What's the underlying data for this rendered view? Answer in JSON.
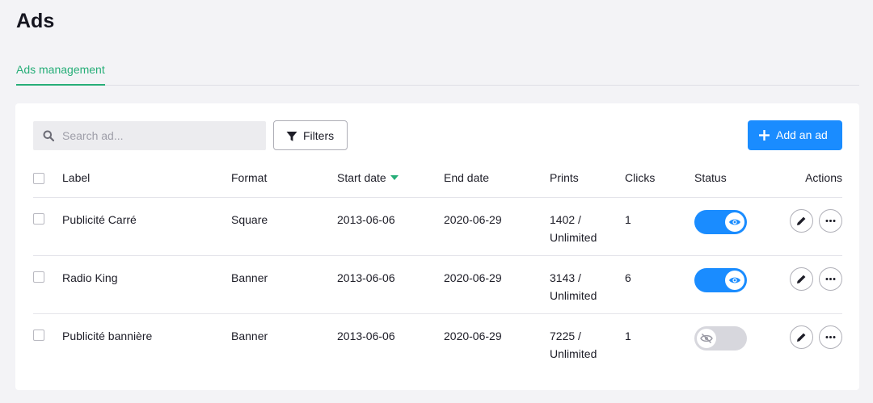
{
  "page": {
    "title": "Ads"
  },
  "tabs": [
    {
      "label": "Ads management",
      "active": true
    }
  ],
  "toolbar": {
    "search_placeholder": "Search ad...",
    "search_value": "",
    "filters_label": "Filters",
    "add_label": "Add an ad"
  },
  "table": {
    "columns": [
      "Label",
      "Format",
      "Start date",
      "End date",
      "Prints",
      "Clicks",
      "Status",
      "Actions"
    ],
    "sorted_column": "Start date",
    "sort_direction": "desc",
    "rows": [
      {
        "label": "Publicité Carré",
        "format": "Square",
        "start": "2013-06-06",
        "end": "2020-06-29",
        "prints": "1402 /",
        "prints_limit": "Unlimited",
        "clicks": "1",
        "status_on": true,
        "checked": false
      },
      {
        "label": "Radio King",
        "format": "Banner",
        "start": "2013-06-06",
        "end": "2020-06-29",
        "prints": "3143 /",
        "prints_limit": "Unlimited",
        "clicks": "6",
        "status_on": true,
        "checked": false
      },
      {
        "label": "Publicité bannière",
        "format": "Banner",
        "start": "2013-06-06",
        "end": "2020-06-29",
        "prints": "7225 /",
        "prints_limit": "Unlimited",
        "clicks": "1",
        "status_on": false,
        "checked": false
      }
    ]
  },
  "colors": {
    "accent_green": "#27ae78",
    "primary_blue": "#1a8cff",
    "toggle_off": "#d7d7dd",
    "background": "#f3f3f6"
  },
  "icons": {
    "search": "search-icon",
    "filters": "filter-icon",
    "add": "plus-icon",
    "status_on": "eye-icon",
    "status_off": "eye-off-icon",
    "edit": "pencil-icon",
    "more": "more-dots-icon"
  }
}
